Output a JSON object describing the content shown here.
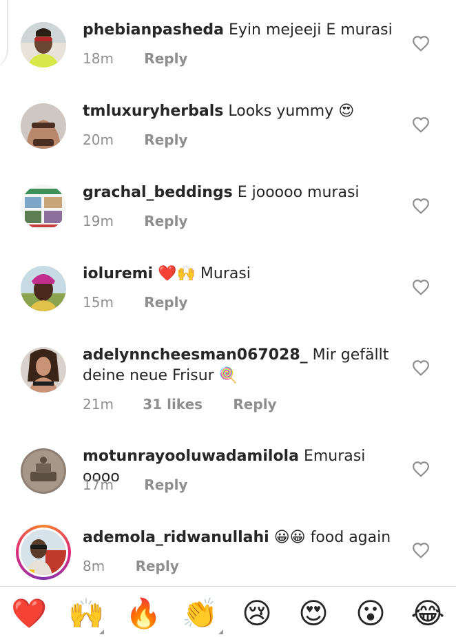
{
  "comments": [
    {
      "username": "phebianpasheda",
      "text": "Eyin mejeeji E murasi",
      "emoji_suffix": "",
      "time": "18m",
      "likes": "",
      "reply": "Reply"
    },
    {
      "username": "tmluxuryherbals",
      "text": "Looks yummy",
      "emoji_suffix": "😍",
      "time": "20m",
      "likes": "",
      "reply": "Reply"
    },
    {
      "username": "grachal_beddings",
      "text": "E jooooo murasi",
      "emoji_suffix": "",
      "time": "19m",
      "likes": "",
      "reply": "Reply"
    },
    {
      "username": "ioluremi",
      "emoji_prefix": "❤️🙌",
      "text": "Murasi",
      "time": "15m",
      "likes": "",
      "reply": "Reply"
    },
    {
      "username": "adelynncheesman067028_",
      "text": "Mir gefällt deine neue Frisur",
      "emoji_suffix": "🍭",
      "time": "21m",
      "likes": "31 likes",
      "reply": "Reply"
    },
    {
      "username": "motunrayooluwadamilola",
      "text": "Emurasi oooo",
      "emoji_suffix": "",
      "time": "17m",
      "likes": "",
      "reply": "Reply"
    },
    {
      "username": "ademola_ridwanullahi",
      "emoji_prefix": "😀😀",
      "text": "food again",
      "time": "8m",
      "likes": "",
      "reply": "Reply"
    }
  ],
  "reactions": [
    "❤️",
    "🙌",
    "🔥",
    "👏",
    "😢",
    "😍",
    "😮",
    "😂"
  ],
  "icons": {
    "like": "heart-outline-icon"
  },
  "colors": {
    "text": "#262626",
    "secondary": "#8e8e8e",
    "heart_outline": "#8e8e8e"
  }
}
